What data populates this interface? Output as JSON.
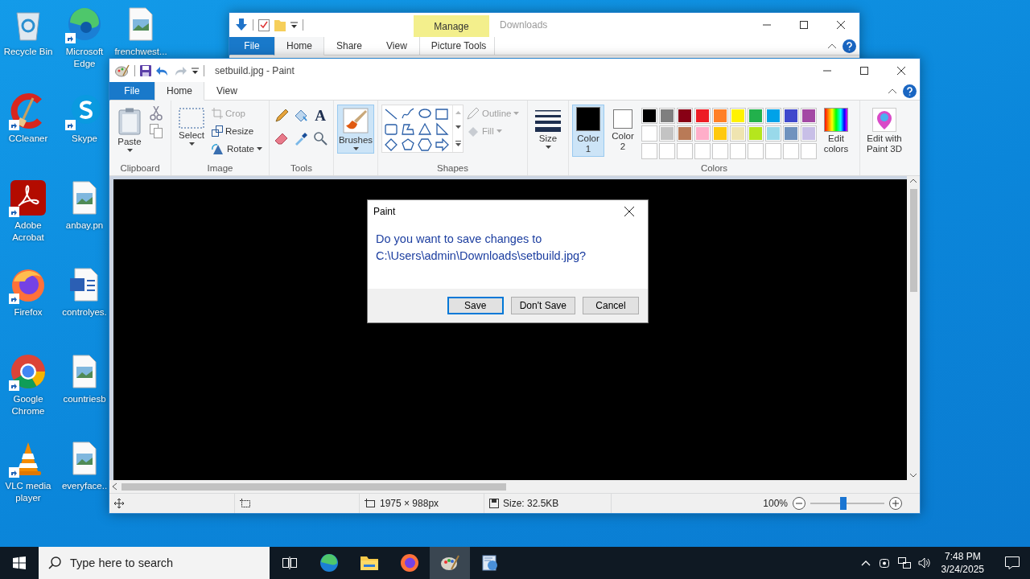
{
  "desktop": {
    "icons": [
      {
        "kind": "recycle-bin",
        "label": "Recycle Bin",
        "shortcut": false
      },
      {
        "kind": "ccleaner",
        "label": "CCleaner",
        "shortcut": true
      },
      {
        "kind": "acrobat",
        "label": "Adobe Acrobat",
        "shortcut": true
      },
      {
        "kind": "firefox",
        "label": "Firefox",
        "shortcut": true
      },
      {
        "kind": "chrome",
        "label": "Google Chrome",
        "shortcut": true
      },
      {
        "kind": "vlc",
        "label": "VLC media player",
        "shortcut": true
      },
      {
        "kind": "edge",
        "label": "Microsoft Edge",
        "shortcut": true
      },
      {
        "kind": "skype",
        "label": "Skype",
        "shortcut": true
      },
      {
        "kind": "image",
        "label": "anbay.pn",
        "shortcut": false
      },
      {
        "kind": "word",
        "label": "controlyes.",
        "shortcut": false
      },
      {
        "kind": "image",
        "label": "countriesb",
        "shortcut": false
      },
      {
        "kind": "image",
        "label": "everyface..",
        "shortcut": false
      },
      {
        "kind": "image",
        "label": "frenchwest...",
        "shortcut": false
      }
    ]
  },
  "explorer": {
    "title": "Downloads",
    "context_header": "Manage",
    "tabs": [
      {
        "label": "File",
        "kind": "file",
        "selected": false
      },
      {
        "label": "Home",
        "kind": "tab",
        "selected": true
      },
      {
        "label": "Share",
        "kind": "tab",
        "selected": false
      },
      {
        "label": "View",
        "kind": "tab",
        "selected": false
      },
      {
        "label": "Picture Tools",
        "kind": "context",
        "selected": false
      }
    ]
  },
  "paint": {
    "title": "setbuild.jpg - Paint",
    "tabs": [
      {
        "label": "File",
        "kind": "file",
        "selected": false
      },
      {
        "label": "Home",
        "kind": "tab",
        "selected": true
      },
      {
        "label": "View",
        "kind": "tab",
        "selected": false
      }
    ],
    "ribbon": {
      "clipboard": {
        "label": "Clipboard",
        "paste": "Paste"
      },
      "image": {
        "label": "Image",
        "select": "Select",
        "crop": {
          "label": "Crop",
          "disabled": true
        },
        "resize": {
          "label": "Resize",
          "disabled": false
        },
        "rotate": {
          "label": "Rotate",
          "disabled": false
        }
      },
      "tools": {
        "label": "Tools",
        "text_tool": "A"
      },
      "brushes": {
        "label": "Brushes",
        "selected": true
      },
      "shapes": {
        "label": "Shapes",
        "outline": {
          "label": "Outline",
          "disabled": true
        },
        "fill": {
          "label": "Fill",
          "disabled": true
        }
      },
      "size": {
        "label": "Size"
      },
      "colors": {
        "label": "Colors",
        "color1": {
          "label": "Color 1",
          "color": "#000000",
          "selected": true
        },
        "color2": {
          "label": "Color 2",
          "color": "#ffffff",
          "selected": false
        },
        "palette": [
          {
            "color": "#000000"
          },
          {
            "color": "#7f7f7f"
          },
          {
            "color": "#880015"
          },
          {
            "color": "#ed1c24"
          },
          {
            "color": "#ff7f27"
          },
          {
            "color": "#fff200"
          },
          {
            "color": "#22b14c"
          },
          {
            "color": "#00a2e8"
          },
          {
            "color": "#3f48cc"
          },
          {
            "color": "#a349a4"
          },
          {
            "color": "#ffffff"
          },
          {
            "color": "#c3c3c3"
          },
          {
            "color": "#b97a57"
          },
          {
            "color": "#ffaec9"
          },
          {
            "color": "#ffc90e"
          },
          {
            "color": "#efe4b0"
          },
          {
            "color": "#b5e61d"
          },
          {
            "color": "#99d9ea"
          },
          {
            "color": "#7092be"
          },
          {
            "color": "#c8bfe7"
          }
        ],
        "edit_colors": "Edit colors"
      },
      "paint3d": "Edit with Paint 3D"
    },
    "status_bar": {
      "dimensions": "1975 × 988px",
      "size": "Size: 32.5KB",
      "zoom": "100%",
      "level": 0.45
    }
  },
  "dialog": {
    "title": "Paint",
    "message": "Do you want to save changes to C:\\Users\\admin\\Downloads\\setbuild.jpg?",
    "buttons": [
      {
        "label": "Save",
        "selected": true
      },
      {
        "label": "Don't Save",
        "selected": false
      },
      {
        "label": "Cancel",
        "selected": false
      }
    ]
  },
  "taskbar": {
    "search": {
      "placeholder": "Type here to search"
    },
    "apps": [
      {
        "kind": "edge",
        "selected": false
      },
      {
        "kind": "explorer",
        "selected": false
      },
      {
        "kind": "firefox",
        "selected": false
      },
      {
        "kind": "paint",
        "selected": true
      },
      {
        "kind": "installer",
        "selected": false
      }
    ],
    "time": "7:48 PM",
    "date": "3/24/2025"
  }
}
